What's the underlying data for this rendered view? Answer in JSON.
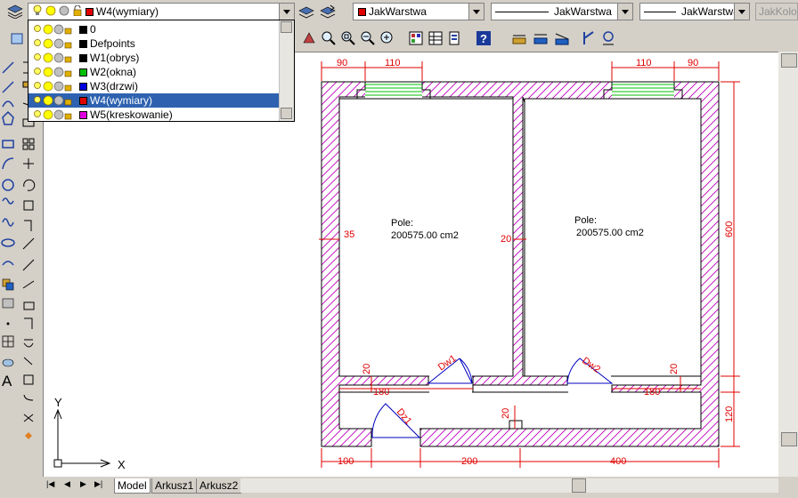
{
  "toolbar": {
    "layer_combo": {
      "value": "W4(wymiary)",
      "color": "#e00000"
    },
    "color_combo": {
      "value": "JakWarstwa",
      "color": "#e00000"
    },
    "linetype_combo": {
      "value": "JakWarstwa"
    },
    "lineweight_combo": {
      "value": "JakWarstwa"
    },
    "plotstyle_combo": {
      "value": "JakKolo"
    }
  },
  "layers_dropdown": {
    "items": [
      {
        "name": "0",
        "color": "#000000"
      },
      {
        "name": "Defpoints",
        "color": "#000000"
      },
      {
        "name": "W1(obrys)",
        "color": "#000000"
      },
      {
        "name": "W2(okna)",
        "color": "#00c000"
      },
      {
        "name": "W3(drzwi)",
        "color": "#0000e0"
      },
      {
        "name": "W4(wymiary)",
        "color": "#e00000",
        "selected": true
      },
      {
        "name": "W5(kreskowanie)",
        "color": "#e000e0"
      }
    ]
  },
  "drawing": {
    "dims_top": [
      "90",
      "110",
      "110",
      "90"
    ],
    "dims_bottom": [
      "100",
      "200",
      "400"
    ],
    "dim_right_upper": "600",
    "dim_right_lower": "120",
    "wall_left": "35",
    "wall_middle": "20",
    "opening_left": "180",
    "opening_right": "180",
    "small_20_left": "20",
    "small_20_right": "20",
    "small_20_bottom": "20",
    "door_labels": [
      "Dw1",
      "Dw2",
      "Dz1"
    ],
    "room_left": {
      "label": "Pole:",
      "area": "200575.00 cm2"
    },
    "room_right": {
      "label": "Pole:",
      "area": "200575.00 cm2"
    },
    "ucs_y": "Y",
    "ucs_x": "X"
  },
  "tabs": [
    "Model",
    "Arkusz1",
    "Arkusz2"
  ],
  "colors": {
    "dimension": "#e00000",
    "hatch": "#c000c0",
    "window": "#00c000",
    "door": "#0000c0",
    "wall": "#000000"
  }
}
